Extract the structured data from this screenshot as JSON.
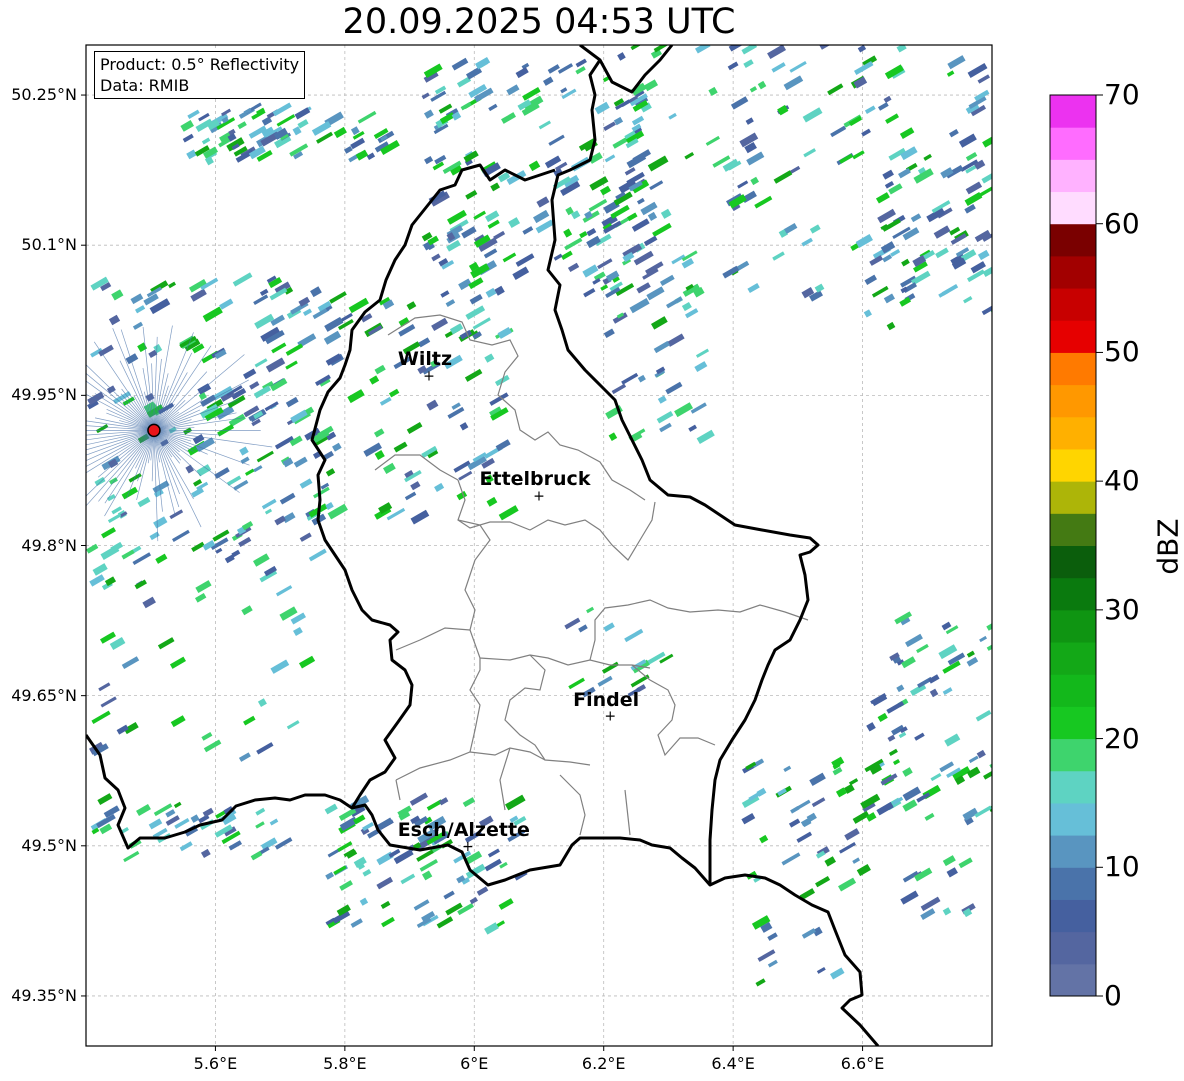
{
  "title": "20.09.2025 04:53 UTC",
  "info": {
    "product": "Product: 0.5° Reflectivity",
    "data": "Data: RMIB"
  },
  "axes": {
    "lat_labels": [
      "50.25°N",
      "50.1°N",
      "49.95°N",
      "49.8°N",
      "49.65°N",
      "49.5°N",
      "49.35°N"
    ],
    "lon_labels": [
      "5.6°E",
      "5.8°E",
      "6°E",
      "6.2°E",
      "6.4°E",
      "6.6°E"
    ],
    "lat_range": [
      49.3,
      50.3
    ],
    "lon_range": [
      5.4,
      6.8
    ],
    "grid": true
  },
  "cities": [
    {
      "name": "Wiltz",
      "lon": 5.93,
      "lat": 49.97
    },
    {
      "name": "Ettelbruck",
      "lon": 6.1,
      "lat": 49.85
    },
    {
      "name": "Findel",
      "lon": 6.21,
      "lat": 49.63
    },
    {
      "name": "Esch/Alzette",
      "lon": 5.99,
      "lat": 49.5
    }
  ],
  "radar_site": {
    "lon": 5.505,
    "lat": 49.915,
    "color": "#e8141a"
  },
  "colorbar": {
    "label": "dBZ",
    "ticks": [
      "0",
      "10",
      "20",
      "30",
      "40",
      "50",
      "60",
      "70"
    ],
    "min": 0,
    "max": 70,
    "colors": [
      "#6373a6",
      "#5466a0",
      "#45609f",
      "#4a73aa",
      "#5995c0",
      "#66bfd8",
      "#5ed3c2",
      "#3ed46d",
      "#17c821",
      "#13b81b",
      "#13a817",
      "#0f9512",
      "#0a7a0e",
      "#0b5e0c",
      "#447a13",
      "#adb508",
      "#ffd500",
      "#ffb000",
      "#ff9800",
      "#ff7a00",
      "#e60000",
      "#c80000",
      "#a20000",
      "#7a0000",
      "#ffdcff",
      "#ffb2ff",
      "#ff6cff",
      "#ec32f0"
    ]
  }
}
